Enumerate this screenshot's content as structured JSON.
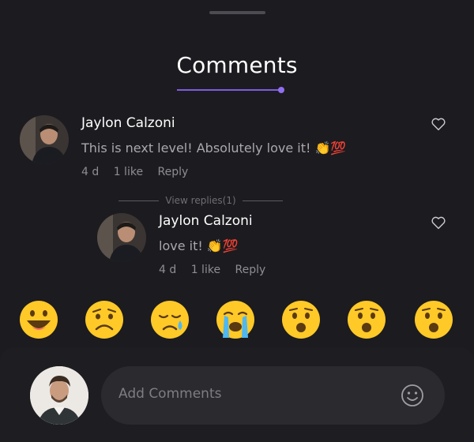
{
  "sheet": {
    "title": "Comments"
  },
  "comments": [
    {
      "author": "Jaylon Calzoni",
      "text": "This is next level! Absolutely love it! 👏💯",
      "time": "4 d",
      "likes": "1 like",
      "reply_label": "Reply"
    }
  ],
  "view_replies_label": "View replies(1)",
  "replies": [
    {
      "author": "Jaylon Calzoni",
      "text": "love it! 👏💯",
      "time": "4 d",
      "likes": "1 like",
      "reply_label": "Reply"
    }
  ],
  "reactions": [
    "grinning-face",
    "frowning-face",
    "sad-tear-face",
    "loudly-crying-face",
    "anguished-face",
    "anguished-face",
    "anguished-face"
  ],
  "composer": {
    "placeholder": "Add Comments"
  },
  "colors": {
    "background": "#1c1b1f",
    "accent": "#7b5ce0",
    "muted_text": "#a9a8ad"
  }
}
